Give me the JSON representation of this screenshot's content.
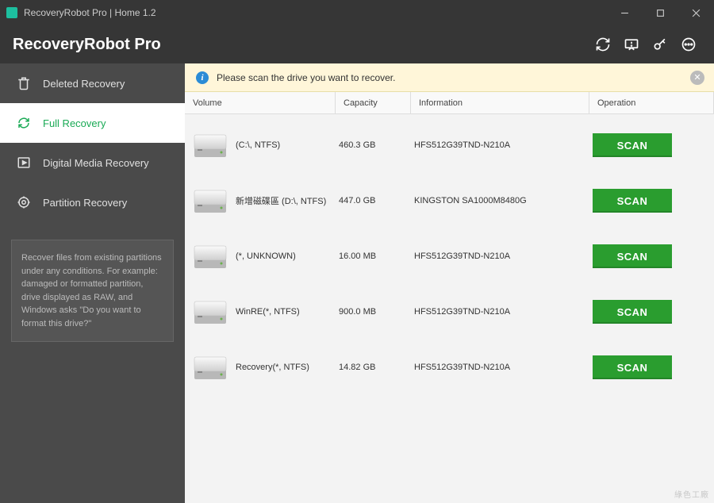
{
  "window": {
    "title": "RecoveryRobot Pro | Home 1.2"
  },
  "header": {
    "app_title": "RecoveryRobot Pro"
  },
  "sidebar": {
    "items": [
      {
        "label": "Deleted Recovery"
      },
      {
        "label": "Full Recovery"
      },
      {
        "label": "Digital Media Recovery"
      },
      {
        "label": "Partition Recovery"
      }
    ],
    "help": "Recover files from existing partitions under any conditions. For example: damaged or formatted partition, drive displayed as RAW, and Windows asks \"Do you want to format this drive?\""
  },
  "notice": {
    "text": "Please scan the drive you want to recover."
  },
  "table": {
    "headers": {
      "volume": "Volume",
      "capacity": "Capacity",
      "information": "Information",
      "operation": "Operation"
    },
    "scan_label": "SCAN",
    "rows": [
      {
        "volume": "(C:\\, NTFS)",
        "capacity": "460.3 GB",
        "info": "HFS512G39TND-N210A"
      },
      {
        "volume": "新增磁碟區 (D:\\, NTFS)",
        "capacity": "447.0 GB",
        "info": "KINGSTON SA1000M8480G"
      },
      {
        "volume": "(*, UNKNOWN)",
        "capacity": "16.00 MB",
        "info": "HFS512G39TND-N210A"
      },
      {
        "volume": "WinRE(*, NTFS)",
        "capacity": "900.0 MB",
        "info": "HFS512G39TND-N210A"
      },
      {
        "volume": "Recovery(*, NTFS)",
        "capacity": "14.82 GB",
        "info": "HFS512G39TND-N210A"
      }
    ]
  },
  "watermark": "綠色工廠"
}
